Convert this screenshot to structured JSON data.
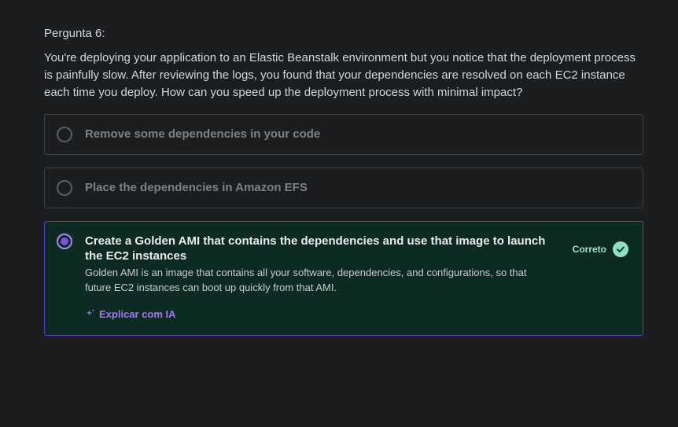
{
  "question": {
    "number_label": "Pergunta 6:",
    "text": "You're deploying your application to an Elastic Beanstalk environment but you notice that the deployment process is painfully slow. After reviewing the logs, you found that your dependencies are resolved on each EC2 instance each time you deploy. How can you speed up the deployment process with minimal impact?"
  },
  "options": [
    {
      "label": "Remove some dependencies in your code",
      "selected": false
    },
    {
      "label": "Place the dependencies in Amazon EFS",
      "selected": false
    },
    {
      "label": "Create a Golden AMI that contains the dependencies and use that image to launch the EC2 instances",
      "selected": true,
      "status": "Correto",
      "explanation": "Golden AMI is an image that contains all your software, dependencies, and configurations, so that future EC2 instances can boot up quickly from that AMI.",
      "ai_link": "Explicar com IA"
    }
  ],
  "icons": {
    "check": "check-circle-icon",
    "ai": "sparkle-icon"
  },
  "colors": {
    "background": "#1c1d1f",
    "correct_bg": "#0d2b23",
    "correct_border": "#5e3ec4",
    "correct_badge": "#8fe0c2",
    "accent_purple": "#a574f2"
  }
}
